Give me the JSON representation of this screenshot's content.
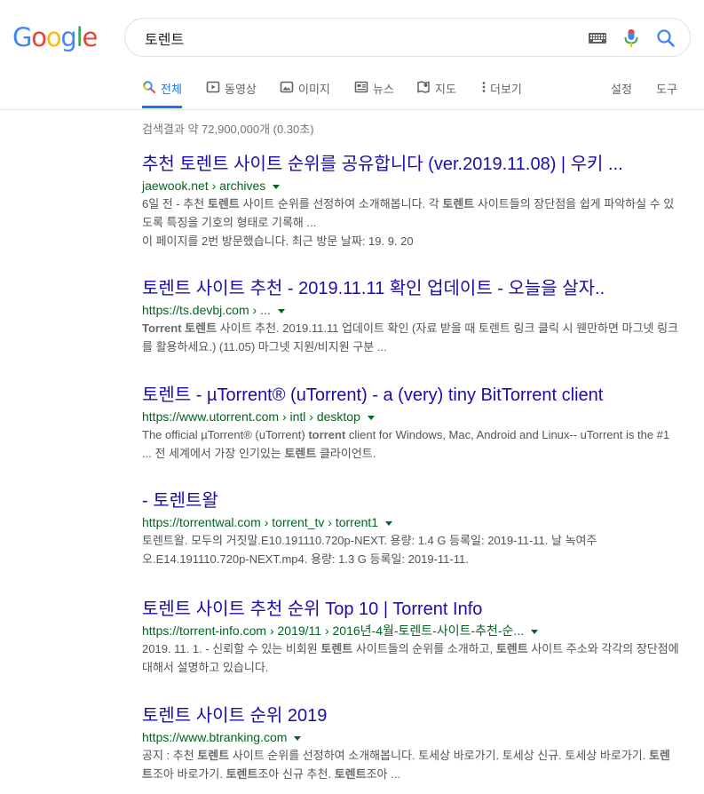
{
  "logo": {
    "letters": [
      "G",
      "o",
      "o",
      "g",
      "l",
      "e"
    ],
    "colors": [
      "#4285f4",
      "#ea4335",
      "#fbbc05",
      "#4285f4",
      "#34a853",
      "#ea4335"
    ]
  },
  "search": {
    "query": "토렌트"
  },
  "tabs": [
    {
      "label": "전체",
      "icon": "search-icon",
      "active": true
    },
    {
      "label": "동영상",
      "icon": "video-icon"
    },
    {
      "label": "이미지",
      "icon": "image-icon"
    },
    {
      "label": "뉴스",
      "icon": "news-icon"
    },
    {
      "label": "지도",
      "icon": "map-icon"
    },
    {
      "label": "더보기",
      "icon": "more-vert-icon"
    }
  ],
  "tools": {
    "settings": "설정",
    "tools": "도구"
  },
  "stats": "검색결과 약 72,900,000개 (0.30초)",
  "results": [
    {
      "title": "추천 토렌트 사이트 순위를 공유합니다 (ver.2019.11.08) | 우키 ...",
      "url": "jaewook.net › archives",
      "snippet": [
        {
          "text": "6일 전 - 추천 "
        },
        {
          "text": "토렌트",
          "bold": true
        },
        {
          "text": " 사이트 순위를 선정하여 소개해봅니다. 각 "
        },
        {
          "text": "토렌트",
          "bold": true
        },
        {
          "text": " 사이트들의 장단점을 쉽게 파악하실 수 있도록 특징을 기호의 형태로 기록해 ..."
        }
      ],
      "visited": "이 페이지를 2번 방문했습니다. 최근 방문 날짜: 19. 9. 20"
    },
    {
      "title": "토렌트 사이트 추천 - 2019.11.11 확인 업데이트 - 오늘을 살자..",
      "url": "https://ts.devbj.com › ...",
      "snippet": [
        {
          "text": "Torrent",
          "bold": true
        },
        {
          "text": " "
        },
        {
          "text": "토렌트",
          "bold": true
        },
        {
          "text": " 사이트 추천. 2019.11.11 업데이트 확인 (자료 받을 때 토렌트 링크 클릭 시 웬만하면 마그넷 링크를 활용하세요.) (11.05) 마그넷 지원/비지원 구분 ..."
        }
      ]
    },
    {
      "title": "토렌트 - µTorrent® (uTorrent) - a (very) tiny BitTorrent client",
      "url": "https://www.utorrent.com › intl › desktop",
      "snippet": [
        {
          "text": "The official µTorrent® (uTorrent) "
        },
        {
          "text": "torrent",
          "bold": true
        },
        {
          "text": " client for Windows, Mac, Android and Linux-- uTorrent is the #1 ... 전 세계에서 가장 인기있는 "
        },
        {
          "text": "토렌트",
          "bold": true
        },
        {
          "text": " 클라이언트."
        }
      ]
    },
    {
      "title": "- 토렌트왈",
      "url": "https://torrentwal.com › torrent_tv › torrent1",
      "snippet": [
        {
          "text": "토렌트왈. 모두의 거짓말.E10.191110.720p-NEXT. 용량: 1.4 G 등록일: 2019-11-11. 날 녹여주오.E14.191110.720p-NEXT.mp4. 용량: 1.3 G 등록일: 2019-11-11."
        }
      ]
    },
    {
      "title": "토렌트 사이트 추천 순위 Top 10 | Torrent Info",
      "url": "https://torrent-info.com › 2019/11 › 2016년-4월-토렌트-사이트-추천-순...",
      "snippet": [
        {
          "text": "2019. 11. 1. - 신뢰할 수 있는 비회원 "
        },
        {
          "text": "토렌트",
          "bold": true
        },
        {
          "text": " 사이트들의 순위를 소개하고, "
        },
        {
          "text": "토렌트",
          "bold": true
        },
        {
          "text": " 사이트 주소와 각각의 장단점에 대해서 설명하고 있습니다."
        }
      ]
    },
    {
      "title": "토렌트 사이트 순위 2019",
      "url": "https://www.btranking.com",
      "snippet": [
        {
          "text": "공지 : 추천 "
        },
        {
          "text": "토렌트",
          "bold": true
        },
        {
          "text": " 사이트 순위를 선정하여 소개해봅니다. 토세상 바로가기. 토세상 신규. 토세상 바로가기. "
        },
        {
          "text": "토렌트",
          "bold": true
        },
        {
          "text": "조아 바로가기. "
        },
        {
          "text": "토렌트",
          "bold": true
        },
        {
          "text": "조아 신규 추천. "
        },
        {
          "text": "토렌트",
          "bold": true
        },
        {
          "text": "조아 ..."
        }
      ]
    }
  ]
}
